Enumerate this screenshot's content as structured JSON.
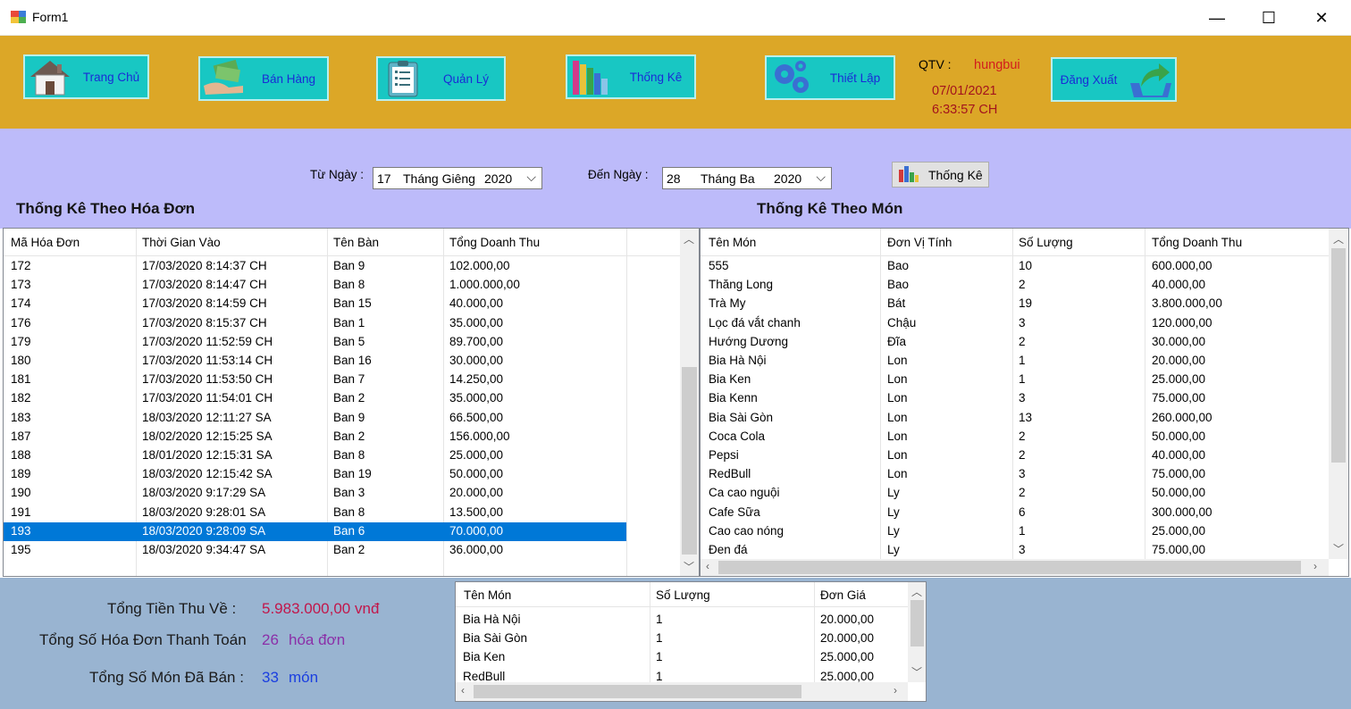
{
  "window": {
    "title": "Form1",
    "minimize": "—",
    "maximize": "☐",
    "close": "✕"
  },
  "nav": [
    {
      "label": "Trang Chủ",
      "icon": "house-icon"
    },
    {
      "label": "Bán Hàng",
      "icon": "money-handshake-icon"
    },
    {
      "label": "Quản Lý",
      "icon": "clipboard-list-icon"
    },
    {
      "label": "Thống Kê",
      "icon": "books-chart-icon"
    },
    {
      "label": "Thiết Lập",
      "icon": "gears-icon"
    }
  ],
  "user": {
    "label": "QTV :",
    "name": "hungbui",
    "date": "07/01/2021",
    "time": "6:33:57 CH"
  },
  "logout": {
    "label": "Đăng Xuất",
    "icon": "logout-arrow-icon"
  },
  "filter": {
    "from_label": "Từ Ngày :",
    "from_day": "17",
    "from_month": "Tháng Giêng",
    "from_year": "2020",
    "to_label": "Đến Ngày :",
    "to_day": "28",
    "to_month": "Tháng Ba",
    "to_year": "2020",
    "stat_button": "Thống Kê"
  },
  "invoices": {
    "title": "Thống Kê Theo Hóa Đơn",
    "columns": [
      "Mã Hóa Đơn",
      "Thời Gian Vào",
      "Tên Bàn",
      "Tổng Doanh Thu"
    ],
    "rows": [
      [
        "172",
        "17/03/2020 8:14:37 CH",
        "Ban 9",
        "102.000,00"
      ],
      [
        "173",
        "17/03/2020 8:14:47 CH",
        "Ban 8",
        "1.000.000,00"
      ],
      [
        "174",
        "17/03/2020 8:14:59 CH",
        "Ban 15",
        "40.000,00"
      ],
      [
        "176",
        "17/03/2020 8:15:37 CH",
        "Ban 1",
        "35.000,00"
      ],
      [
        "179",
        "17/03/2020 11:52:59 CH",
        "Ban 5",
        "89.700,00"
      ],
      [
        "180",
        "17/03/2020 11:53:14 CH",
        "Ban 16",
        "30.000,00"
      ],
      [
        "181",
        "17/03/2020 11:53:50 CH",
        "Ban 7",
        "14.250,00"
      ],
      [
        "182",
        "17/03/2020 11:54:01 CH",
        "Ban 2",
        "35.000,00"
      ],
      [
        "183",
        "18/03/2020 12:11:27 SA",
        "Ban 9",
        "66.500,00"
      ],
      [
        "187",
        "18/02/2020 12:15:25 SA",
        "Ban 2",
        "156.000,00"
      ],
      [
        "188",
        "18/01/2020 12:15:31 SA",
        "Ban 8",
        "25.000,00"
      ],
      [
        "189",
        "18/03/2020 12:15:42 SA",
        "Ban 19",
        "50.000,00"
      ],
      [
        "190",
        "18/03/2020 9:17:29 SA",
        "Ban 3",
        "20.000,00"
      ],
      [
        "191",
        "18/03/2020 9:28:01 SA",
        "Ban 8",
        "13.500,00"
      ],
      [
        "193",
        "18/03/2020 9:28:09 SA",
        "Ban 6",
        "70.000,00"
      ],
      [
        "195",
        "18/03/2020 9:34:47 SA",
        "Ban 2",
        "36.000,00"
      ]
    ],
    "selected_row": 14
  },
  "items": {
    "title": "Thống Kê Theo Món",
    "columns": [
      "Tên Món",
      "Đơn Vị Tính",
      "Số Lượng",
      "Tổng Doanh Thu"
    ],
    "rows": [
      [
        "555",
        "Bao",
        "10",
        "600.000,00"
      ],
      [
        "Thăng Long",
        "Bao",
        "2",
        "40.000,00"
      ],
      [
        "Trà My",
        "Bát",
        "19",
        "3.800.000,00"
      ],
      [
        "Lọc đá vắt chanh",
        "Chậu",
        "3",
        "120.000,00"
      ],
      [
        "Hướng Dương",
        "Đĩa",
        "2",
        "30.000,00"
      ],
      [
        "Bia Hà Nội",
        "Lon",
        "1",
        "20.000,00"
      ],
      [
        "Bia Ken",
        "Lon",
        "1",
        "25.000,00"
      ],
      [
        "Bia Kenn",
        "Lon",
        "3",
        "75.000,00"
      ],
      [
        "Bia Sài Gòn",
        "Lon",
        "13",
        "260.000,00"
      ],
      [
        "Coca Cola",
        "Lon",
        "2",
        "50.000,00"
      ],
      [
        "Pepsi",
        "Lon",
        "2",
        "40.000,00"
      ],
      [
        "RedBull",
        "Lon",
        "3",
        "75.000,00"
      ],
      [
        "Ca cao nguội",
        "Ly",
        "2",
        "50.000,00"
      ],
      [
        "Cafe Sữa",
        "Ly",
        "6",
        "300.000,00"
      ],
      [
        "Cao cao nóng",
        "Ly",
        "1",
        "25.000,00"
      ],
      [
        "Đen đá",
        "Ly",
        "3",
        "75.000,00"
      ]
    ]
  },
  "details": {
    "columns": [
      "Tên Món",
      "Số Lượng",
      "Đơn Giá"
    ],
    "rows": [
      [
        "Bia Hà Nội",
        "1",
        "20.000,00"
      ],
      [
        "Bia Sài Gòn",
        "1",
        "20.000,00"
      ],
      [
        "Bia Ken",
        "1",
        "25.000,00"
      ],
      [
        "RedBull",
        "1",
        "25.000,00"
      ]
    ]
  },
  "summary": {
    "revenue_label": "Tổng Tiền Thu Về :",
    "revenue_value": "5.983.000,00 vnđ",
    "invoices_label": "Tổng Số Hóa Đơn Thanh Toán",
    "invoices_value": "26",
    "invoices_unit": "hóa đơn",
    "items_label": "Tổng Số Món Đã Bán :",
    "items_value": "33",
    "items_unit": "món"
  },
  "colors": {
    "header": "#dca727",
    "nav_button": "#18c7c3",
    "filter_panel": "#bdbbfa",
    "bottom_panel": "#99b4d1",
    "selection": "#0078d7"
  }
}
